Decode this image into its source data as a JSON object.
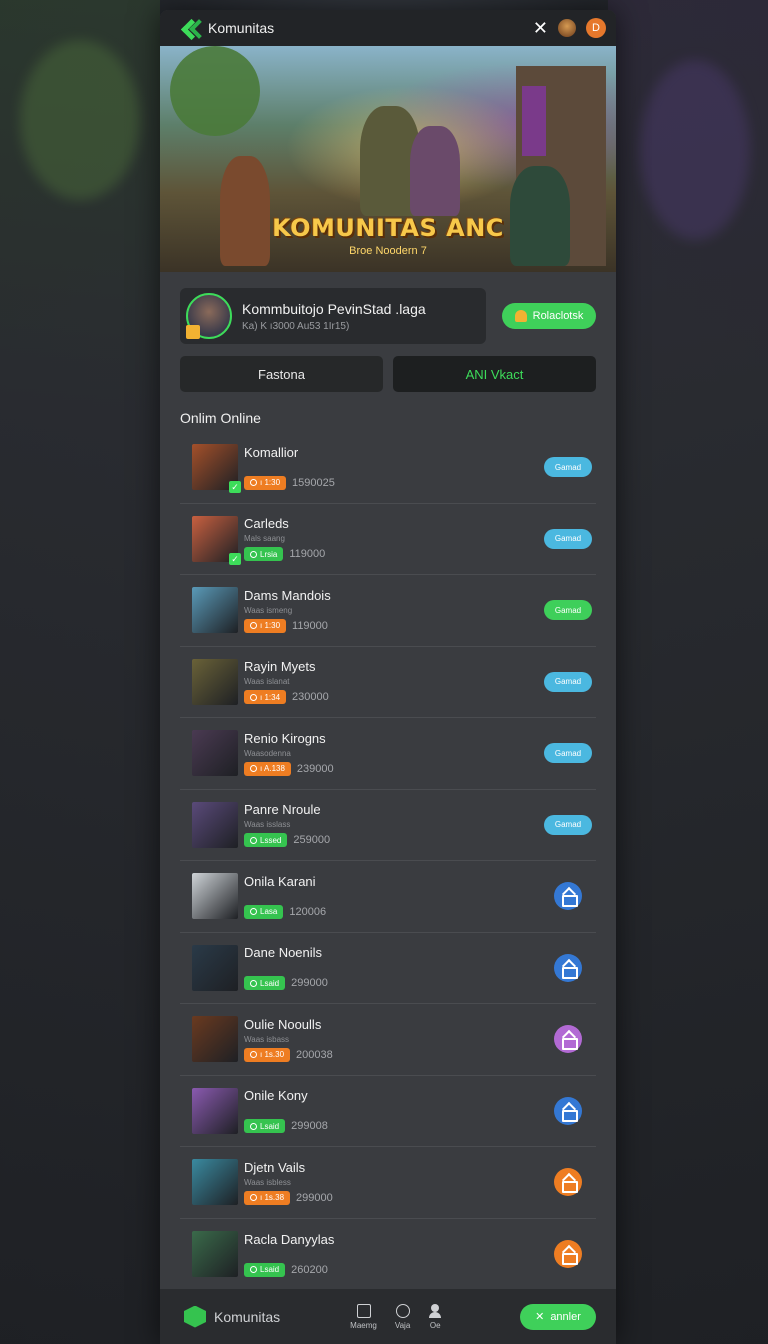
{
  "header": {
    "app_title": "Komunitas",
    "close_glyph": "✕",
    "notif_label": "D"
  },
  "hero": {
    "title": "KOMUNITAS ANC",
    "subtitle": "Broe  Noodern 7"
  },
  "profile": {
    "name": "Kommbuitojo PevinStad .laga",
    "meta": "Ka) K ı3000 Au53 1Ir15)",
    "action_label": "Rolaclotsk"
  },
  "tabs": [
    {
      "label": "Fastona",
      "active": false
    },
    {
      "label": "ANI Vkact",
      "active": true
    }
  ],
  "section_label": "Onlim Online",
  "members": [
    {
      "name": "Komallior",
      "sub": "",
      "chip": "ı 1:30",
      "chip_color": "orange",
      "count": "1590025",
      "action_type": "pill",
      "action_label": "Gamad",
      "action_color": "#4bb8e0",
      "thumb": "#a4502a",
      "checked": true
    },
    {
      "name": "Carleds",
      "sub": "Mals saang",
      "chip": "Lrsia",
      "chip_color": "green",
      "count": "119000",
      "action_type": "pill",
      "action_label": "Gamad",
      "action_color": "#4bb8e0",
      "thumb": "#c86040",
      "checked": true
    },
    {
      "name": "Dams Mandois",
      "sub": "Waas ismeng",
      "chip": "ı 1:30",
      "chip_color": "orange",
      "count": "119000",
      "action_type": "pill",
      "action_label": "Gamad",
      "action_color": "#3ecf5a",
      "thumb": "#5a9ab8",
      "checked": false
    },
    {
      "name": "Rayin Myets",
      "sub": "Waas islanat",
      "chip": "ı 1:34",
      "chip_color": "orange",
      "count": "230000",
      "action_type": "pill",
      "action_label": "Gamad",
      "action_color": "#4bb8e0",
      "thumb": "#6a6238",
      "checked": false
    },
    {
      "name": "Renio Kirogns",
      "sub": "Waasodenna",
      "chip": "ı A.138",
      "chip_color": "orange",
      "count": "239000",
      "action_type": "pill",
      "action_label": "Gamad",
      "action_color": "#4bb8e0",
      "thumb": "#4a3a52",
      "checked": false
    },
    {
      "name": "Panre Nroule",
      "sub": "Waas isslass",
      "chip": "Lssed",
      "chip_color": "green",
      "count": "259000",
      "action_type": "pill",
      "action_label": "Gamad",
      "action_color": "#4bb8e0",
      "thumb": "#5a4a7a",
      "checked": false
    },
    {
      "name": "Onila Karani",
      "sub": "",
      "chip": "Lasa",
      "chip_color": "green",
      "count": "120006",
      "action_type": "circle",
      "action_label": "",
      "action_color": "#3478d4",
      "thumb": "#cfd4d8",
      "checked": false
    },
    {
      "name": "Dane Noenils",
      "sub": "",
      "chip": "Lsaid",
      "chip_color": "green",
      "count": "299000",
      "action_type": "circle",
      "action_label": "",
      "action_color": "#3478d4",
      "thumb": "#2a3a48",
      "checked": false
    },
    {
      "name": "Oulie Nooulls",
      "sub": "Waas isbass",
      "chip": "ı 1s.30",
      "chip_color": "orange",
      "count": "200038",
      "action_type": "circle",
      "action_label": "",
      "action_color": "#b26ad4",
      "thumb": "#6a3a20",
      "checked": false
    },
    {
      "name": "Onile Kony",
      "sub": "",
      "chip": "Lsaid",
      "chip_color": "green",
      "count": "299008",
      "action_type": "circle",
      "action_label": "",
      "action_color": "#3478d4",
      "thumb": "#8a5ab0",
      "checked": false
    },
    {
      "name": "Djetn Vails",
      "sub": "Waas isbless",
      "chip": "ı 1s.38",
      "chip_color": "orange",
      "count": "299000",
      "action_type": "circle",
      "action_label": "",
      "action_color": "#ee7d22",
      "thumb": "#3a8aa0",
      "checked": false
    },
    {
      "name": "Racla Danyylas",
      "sub": "",
      "chip": "Lsaid",
      "chip_color": "green",
      "count": "260200",
      "action_type": "circle",
      "action_label": "",
      "action_color": "#ee7d22",
      "thumb": "#3a6a4a",
      "checked": false
    }
  ],
  "bottom_nav": {
    "title": "Komunitas",
    "items": [
      {
        "label": "Maemg",
        "icon": "box-icon"
      },
      {
        "label": "Vaja",
        "icon": "refresh-icon"
      },
      {
        "label": "Oe",
        "icon": "person-icon"
      }
    ],
    "cta_label": "annler",
    "cta_glyph": "✕"
  },
  "colors": {
    "accent_green": "#3ddc5a",
    "chip_orange": "#ee7d22",
    "panel_bg": "#3a3c40"
  }
}
